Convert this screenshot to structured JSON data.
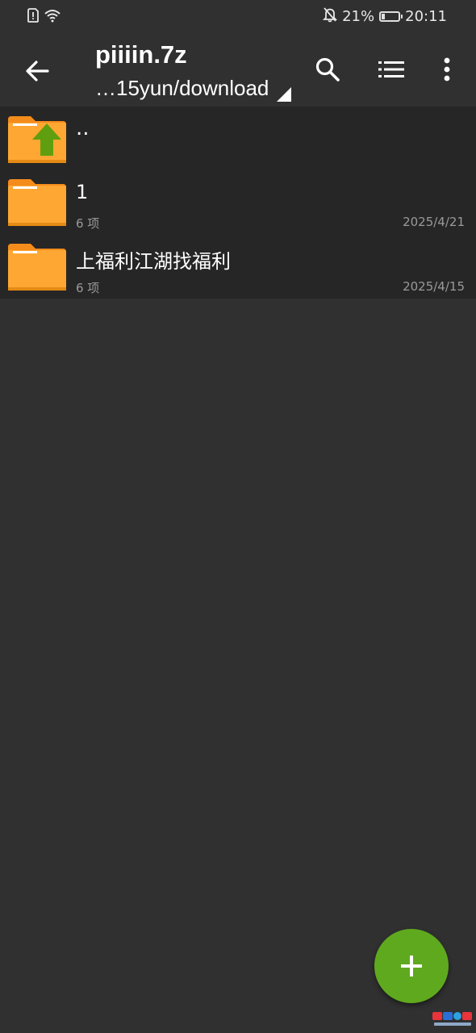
{
  "status_bar": {
    "battery_text": "21%",
    "battery_level": 0.21,
    "time": "20:11",
    "icons": [
      "sim-alert-icon",
      "wifi-icon",
      "bell-off-icon",
      "battery-icon"
    ]
  },
  "toolbar": {
    "title": "piiiin.7z",
    "path": "…15yun/download",
    "icons": [
      "arrow-back-icon",
      "search-icon",
      "list-view-icon",
      "more-vert-icon"
    ]
  },
  "files": {
    "parent": {
      "name": "..",
      "icon": "folder-up-icon"
    },
    "items": [
      {
        "name": "1",
        "meta": "6 项",
        "date": "2025/4/21",
        "icon": "folder-icon"
      },
      {
        "name": "上福利江湖找福利",
        "meta": "6 项",
        "date": "2025/4/15",
        "icon": "folder-icon"
      }
    ]
  },
  "fab": {
    "icon": "plus-icon"
  },
  "colors": {
    "background": "#303030",
    "list_background": "#262626",
    "folder": "#ffa733",
    "folder_tab": "#f48c1c",
    "up_arrow": "#5f9e0f",
    "fab": "#5fa91e"
  }
}
